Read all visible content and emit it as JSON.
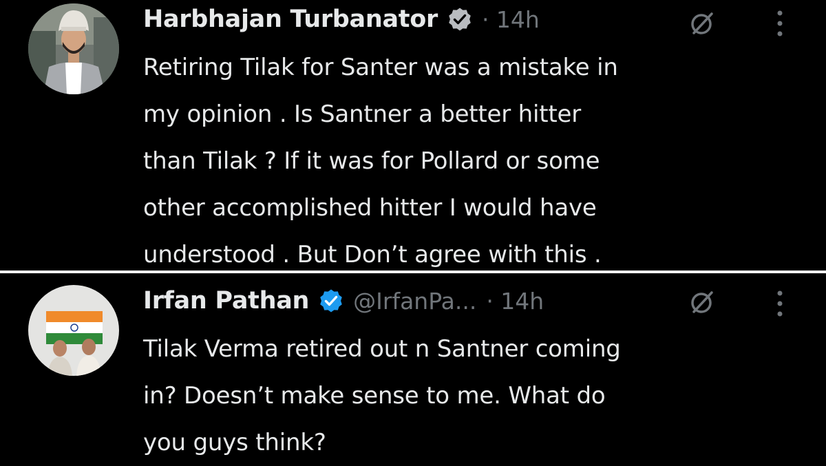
{
  "tweets": [
    {
      "author_name": "Harbhajan Turbanator",
      "handle": "",
      "time": "· 14h",
      "verified": true,
      "body_lines": [
        "Retiring Tilak for Santer was a mistake in",
        "my opinion . Is Santner a better hitter",
        "than Tilak ? If it was for Pollard or some",
        "other accomplished hitter I would have",
        "understood . But Don’t agree with this ."
      ],
      "icons": {
        "grok": "grok-icon",
        "more": "more-vertical-icon",
        "verified": "verified-badge-icon"
      }
    },
    {
      "author_name": "Irfan Pathan",
      "handle": "@IrfanPa...",
      "time": "· 14h",
      "verified": true,
      "body_lines": [
        "Tilak Verma retired out n Santner coming",
        "in? Doesn’t make sense to me. What do",
        "you guys think?"
      ],
      "icons": {
        "grok": "grok-icon",
        "more": "more-vertical-icon",
        "verified": "verified-badge-icon"
      }
    }
  ],
  "colors": {
    "background": "#000000",
    "text_primary": "#e7e9ea",
    "text_secondary": "#71767b",
    "verified_blue_1": "#b9bcc0",
    "verified_blue_2": "#1d9bf0",
    "divider": "#ffffff"
  }
}
